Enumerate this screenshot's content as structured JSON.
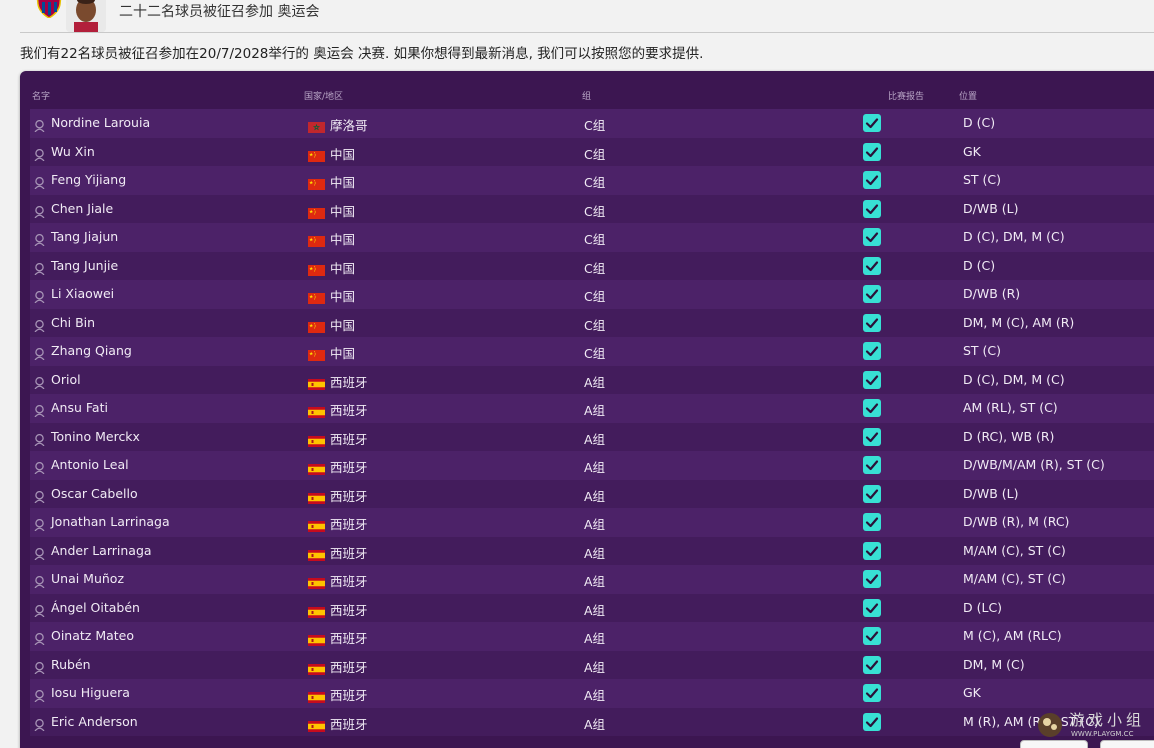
{
  "header": {
    "title": "二十二名球员被征召参加 奥运会"
  },
  "subtitle": "我们有22名球员被征召参加在20/7/2028举行的 奥运会 决赛. 如果你想得到最新消息, 我们可以按照您的要求提供.",
  "table": {
    "columns": {
      "name": "名字",
      "nation": "国家/地区",
      "group": "组",
      "report": "比赛报告",
      "position": "位置"
    },
    "rows": [
      {
        "name": "Nordine Larouia",
        "flag": "morocco",
        "country": "摩洛哥",
        "group": "C组",
        "report": true,
        "position": "D (C)"
      },
      {
        "name": "Wu Xin",
        "flag": "china",
        "country": "中国",
        "group": "C组",
        "report": true,
        "position": "GK"
      },
      {
        "name": "Feng Yijiang",
        "flag": "china",
        "country": "中国",
        "group": "C组",
        "report": true,
        "position": "ST (C)"
      },
      {
        "name": "Chen Jiale",
        "flag": "china",
        "country": "中国",
        "group": "C组",
        "report": true,
        "position": "D/WB (L)"
      },
      {
        "name": "Tang Jiajun",
        "flag": "china",
        "country": "中国",
        "group": "C组",
        "report": true,
        "position": "D (C), DM, M (C)"
      },
      {
        "name": "Tang Junjie",
        "flag": "china",
        "country": "中国",
        "group": "C组",
        "report": true,
        "position": "D (C)"
      },
      {
        "name": "Li Xiaowei",
        "flag": "china",
        "country": "中国",
        "group": "C组",
        "report": true,
        "position": "D/WB (R)"
      },
      {
        "name": "Chi Bin",
        "flag": "china",
        "country": "中国",
        "group": "C组",
        "report": true,
        "position": "DM, M (C), AM (R)"
      },
      {
        "name": "Zhang Qiang",
        "flag": "china",
        "country": "中国",
        "group": "C组",
        "report": true,
        "position": "ST (C)"
      },
      {
        "name": "Oriol",
        "flag": "spain",
        "country": "西班牙",
        "group": "A组",
        "report": true,
        "position": "D (C), DM, M (C)"
      },
      {
        "name": "Ansu Fati",
        "flag": "spain",
        "country": "西班牙",
        "group": "A组",
        "report": true,
        "position": "AM (RL), ST (C)"
      },
      {
        "name": "Tonino Merckx",
        "flag": "spain",
        "country": "西班牙",
        "group": "A组",
        "report": true,
        "position": "D (RC), WB (R)"
      },
      {
        "name": "Antonio Leal",
        "flag": "spain",
        "country": "西班牙",
        "group": "A组",
        "report": true,
        "position": "D/WB/M/AM (R), ST (C)"
      },
      {
        "name": "Oscar Cabello",
        "flag": "spain",
        "country": "西班牙",
        "group": "A组",
        "report": true,
        "position": "D/WB (L)"
      },
      {
        "name": "Jonathan Larrinaga",
        "flag": "spain",
        "country": "西班牙",
        "group": "A组",
        "report": true,
        "position": "D/WB (R), M (RC)"
      },
      {
        "name": "Ander Larrinaga",
        "flag": "spain",
        "country": "西班牙",
        "group": "A组",
        "report": true,
        "position": "M/AM (C), ST (C)"
      },
      {
        "name": "Unai Muñoz",
        "flag": "spain",
        "country": "西班牙",
        "group": "A组",
        "report": true,
        "position": "M/AM (C), ST (C)"
      },
      {
        "name": "Ángel Oitabén",
        "flag": "spain",
        "country": "西班牙",
        "group": "A组",
        "report": true,
        "position": "D (LC)"
      },
      {
        "name": "Oinatz Mateo",
        "flag": "spain",
        "country": "西班牙",
        "group": "A组",
        "report": true,
        "position": "M (C), AM (RLC)"
      },
      {
        "name": "Rubén",
        "flag": "spain",
        "country": "西班牙",
        "group": "A组",
        "report": true,
        "position": "DM, M (C)"
      },
      {
        "name": "Iosu Higuera",
        "flag": "spain",
        "country": "西班牙",
        "group": "A组",
        "report": true,
        "position": "GK"
      },
      {
        "name": "Eric Anderson",
        "flag": "spain",
        "country": "西班牙",
        "group": "A组",
        "report": true,
        "position": "M (R), AM (RL), ST (C)"
      }
    ]
  },
  "watermark": {
    "text": "游戏小组",
    "url": "WWW.PLAYGM.CC"
  },
  "colors": {
    "panel": "#3c1651",
    "row_odd": "#4c2268",
    "row_even": "#431c5c",
    "checkbox": "#38e0d4",
    "text": "#f1ebf5",
    "header_text": "#b9a6c6"
  },
  "icons": {
    "player": "person-icon",
    "report": "checkmark-icon",
    "club": "club-crest-icon"
  }
}
